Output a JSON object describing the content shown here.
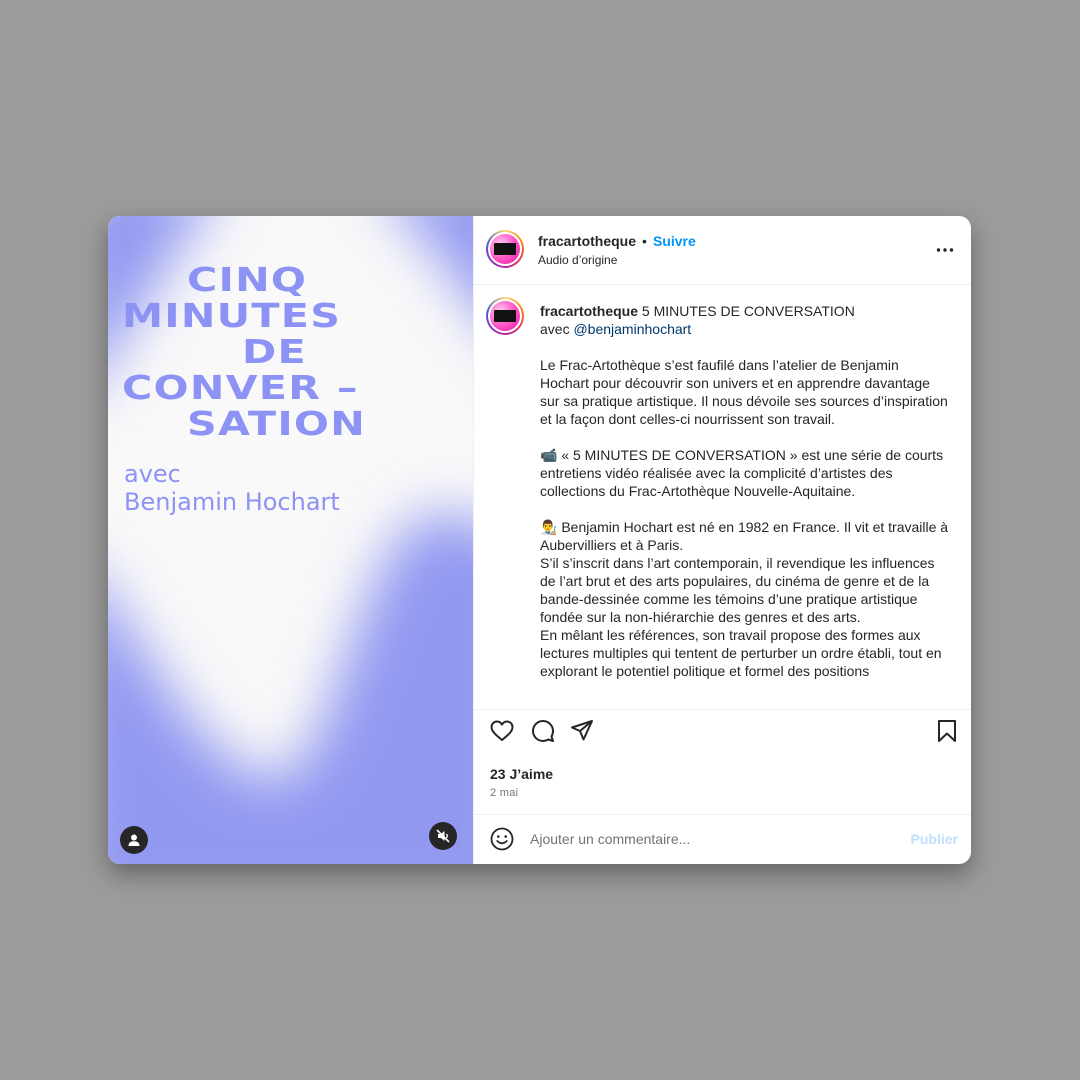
{
  "media": {
    "poster_title_lines": [
      "CINQ",
      "MINUTES",
      "DE",
      "CONVER –",
      "SATION"
    ],
    "poster_sub_lines": [
      "avec",
      "Benjamin Hochart"
    ],
    "accent_color": "#8c93f5",
    "user_icon": "user-icon",
    "mute_icon": "speaker-muted-icon"
  },
  "header": {
    "username": "fracartotheque",
    "separator": "•",
    "follow_label": "Suivre",
    "audio_label": "Audio d’origine",
    "more_icon": "more-horizontal-icon"
  },
  "caption": {
    "username": "fracartotheque",
    "headline": " 5 MINUTES DE CONVERSATION",
    "avec": "avec ",
    "mention": "@benjaminhochart",
    "paragraphs": [
      "Le Frac-Artothèque s’est faufilé dans l’atelier de Benjamin Hochart pour découvrir son univers et en apprendre davantage sur sa pratique artistique. Il nous dévoile ses sources d’inspiration et la façon dont celles-ci nourrissent son travail.",
      "📹 « 5 MINUTES DE CONVERSATION » est une série de courts entretiens vidéo réalisée avec la complicité d’artistes des collections du Frac-Artothèque Nouvelle-Aquitaine.",
      "👨‍🎨 Benjamin Hochart est né en 1982 en France. Il vit et travaille à Aubervilliers et à Paris.\nS’il s’inscrit dans l’art contemporain, il revendique les influences de l’art brut et des arts populaires, du cinéma de genre et de la bande-dessinée comme les témoins d’une pratique artistique fondée sur la non-hiérarchie des genres et des arts.\nEn mêlant les références, son travail propose des formes aux lectures multiples qui tentent de perturber un ordre établi, tout en explorant le potentiel politique et formel des positions"
    ]
  },
  "actions": {
    "icons": [
      "heart-icon",
      "comment-icon",
      "share-icon",
      "bookmark-icon"
    ],
    "likes": "23 J’aime",
    "date": "2 mai"
  },
  "comment": {
    "placeholder": "Ajouter un commentaire...",
    "publish_label": "Publier",
    "emoji_icon": "emoji-icon"
  },
  "colors": {
    "background": "#9b9b9b",
    "link": "#0095f6",
    "mention": "#00376b",
    "publish_disabled": "#c0dffd"
  }
}
